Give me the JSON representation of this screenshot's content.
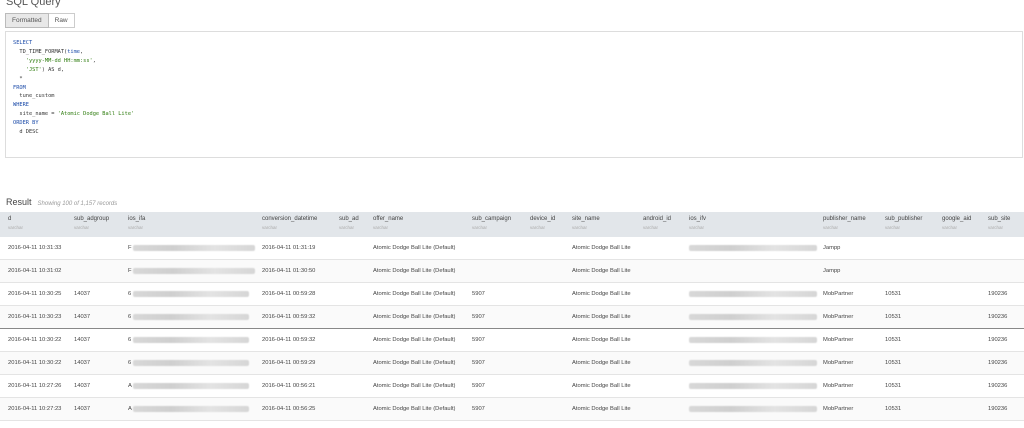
{
  "query": {
    "title": "SQL Query",
    "tabs": [
      {
        "label": "Formatted"
      },
      {
        "label": "Raw"
      }
    ],
    "lines": [
      [
        {
          "t": "SELECT",
          "c": "kw"
        }
      ],
      [
        {
          "t": "  TD_TIME_FORMAT(",
          "c": "fn"
        },
        {
          "t": "time",
          "c": "kw"
        },
        {
          "t": ",",
          "c": "fn"
        }
      ],
      [
        {
          "t": "    'yyyy-MM-dd HH:mm:ss'",
          "c": "str"
        },
        {
          "t": ",",
          "c": "fn"
        }
      ],
      [
        {
          "t": "    'JST'",
          "c": "str"
        },
        {
          "t": ") AS d,",
          "c": "fn"
        }
      ],
      [
        {
          "t": "  *",
          "c": "fn"
        }
      ],
      [
        {
          "t": "FROM",
          "c": "kw"
        }
      ],
      [
        {
          "t": "  tune_custom",
          "c": "fn"
        }
      ],
      [
        {
          "t": "WHERE",
          "c": "kw"
        }
      ],
      [
        {
          "t": "  site_name = ",
          "c": "fn"
        },
        {
          "t": "'Atomic Dodge Ball Lite'",
          "c": "str"
        }
      ],
      [
        {
          "t": "ORDER BY",
          "c": "kw"
        }
      ],
      [
        {
          "t": "  d DESC",
          "c": "fn"
        }
      ]
    ]
  },
  "result": {
    "title": "Result",
    "count": "Showing 100 of 1,157 records",
    "columns": [
      {
        "name": "d",
        "type": "varchar"
      },
      {
        "name": "sub_adgroup",
        "type": "varchar"
      },
      {
        "name": "ios_ifa",
        "type": "varchar"
      },
      {
        "name": "conversion_datetime",
        "type": "varchar"
      },
      {
        "name": "sub_ad",
        "type": "varchar"
      },
      {
        "name": "offer_name",
        "type": "varchar"
      },
      {
        "name": "sub_campaign",
        "type": "varchar"
      },
      {
        "name": "device_id",
        "type": "varchar"
      },
      {
        "name": "site_name",
        "type": "varchar"
      },
      {
        "name": "android_id",
        "type": "varchar"
      },
      {
        "name": "ios_ifv",
        "type": "varchar"
      },
      {
        "name": "publisher_name",
        "type": "varchar"
      },
      {
        "name": "sub_publisher",
        "type": "varchar"
      },
      {
        "name": "google_aid",
        "type": "varchar"
      },
      {
        "name": "sub_site",
        "type": "varchar"
      }
    ],
    "rows": [
      {
        "d": "2016-04-11 10:31:33",
        "sub_adgroup": "",
        "ios_ifa": "F",
        "conversion_datetime": "2016-04-11 01:31:19",
        "sub_ad": "",
        "offer_name": "Atomic Dodge Ball Lite (Default)",
        "sub_campaign": "",
        "device_id": "",
        "site_name": "Atomic Dodge Ball Lite",
        "android_id": "",
        "ios_ifv": "",
        "publisher_name": "Jampp",
        "sub_publisher": "",
        "google_aid": "",
        "sub_site": ""
      },
      {
        "d": "2016-04-11 10:31:02",
        "sub_adgroup": "",
        "ios_ifa": "F",
        "conversion_datetime": "2016-04-11 01:30:50",
        "sub_ad": "",
        "offer_name": "Atomic Dodge Ball Lite (Default)",
        "sub_campaign": "",
        "device_id": "",
        "site_name": "Atomic Dodge Ball Lite",
        "android_id": "",
        "ios_ifv": "",
        "publisher_name": "Jampp",
        "sub_publisher": "",
        "google_aid": "",
        "sub_site": ""
      },
      {
        "d": "2016-04-11 10:30:25",
        "sub_adgroup": "14037",
        "ios_ifa": "6",
        "conversion_datetime": "2016-04-11 00:59:28",
        "sub_ad": "",
        "offer_name": "Atomic Dodge Ball Lite (Default)",
        "sub_campaign": "5907",
        "device_id": "",
        "site_name": "Atomic Dodge Ball Lite",
        "android_id": "",
        "ios_ifv": "",
        "publisher_name": "MobPartner",
        "sub_publisher": "10531",
        "google_aid": "",
        "sub_site": "190236"
      },
      {
        "d": "2016-04-11 10:30:23",
        "sub_adgroup": "14037",
        "ios_ifa": "6",
        "conversion_datetime": "2016-04-11 00:59:32",
        "sub_ad": "",
        "offer_name": "Atomic Dodge Ball Lite (Default)",
        "sub_campaign": "5907",
        "device_id": "",
        "site_name": "Atomic Dodge Ball Lite",
        "android_id": "",
        "ios_ifv": "",
        "publisher_name": "MobPartner",
        "sub_publisher": "10531",
        "google_aid": "",
        "sub_site": "190236"
      },
      {
        "d": "2016-04-11 10:30:22",
        "sub_adgroup": "14037",
        "ios_ifa": "6",
        "conversion_datetime": "2016-04-11 00:59:32",
        "sub_ad": "",
        "offer_name": "Atomic Dodge Ball Lite (Default)",
        "sub_campaign": "5907",
        "device_id": "",
        "site_name": "Atomic Dodge Ball Lite",
        "android_id": "",
        "ios_ifv": "",
        "publisher_name": "MobPartner",
        "sub_publisher": "10531",
        "google_aid": "",
        "sub_site": "190236"
      },
      {
        "d": "2016-04-11 10:30:22",
        "sub_adgroup": "14037",
        "ios_ifa": "6",
        "conversion_datetime": "2016-04-11 00:59:29",
        "sub_ad": "",
        "offer_name": "Atomic Dodge Ball Lite (Default)",
        "sub_campaign": "5907",
        "device_id": "",
        "site_name": "Atomic Dodge Ball Lite",
        "android_id": "",
        "ios_ifv": "",
        "publisher_name": "MobPartner",
        "sub_publisher": "10531",
        "google_aid": "",
        "sub_site": "190236"
      },
      {
        "d": "2016-04-11 10:27:26",
        "sub_adgroup": "14037",
        "ios_ifa": "A",
        "conversion_datetime": "2016-04-11 00:56:21",
        "sub_ad": "",
        "offer_name": "Atomic Dodge Ball Lite (Default)",
        "sub_campaign": "5907",
        "device_id": "",
        "site_name": "Atomic Dodge Ball Lite",
        "android_id": "",
        "ios_ifv": "",
        "publisher_name": "MobPartner",
        "sub_publisher": "10531",
        "google_aid": "",
        "sub_site": "190236"
      },
      {
        "d": "2016-04-11 10:27:23",
        "sub_adgroup": "14037",
        "ios_ifa": "A",
        "conversion_datetime": "2016-04-11 00:56:25",
        "sub_ad": "",
        "offer_name": "Atomic Dodge Ball Lite (Default)",
        "sub_campaign": "5907",
        "device_id": "",
        "site_name": "Atomic Dodge Ball Lite",
        "android_id": "",
        "ios_ifv": "",
        "publisher_name": "MobPartner",
        "sub_publisher": "10531",
        "google_aid": "",
        "sub_site": "190236"
      }
    ]
  }
}
